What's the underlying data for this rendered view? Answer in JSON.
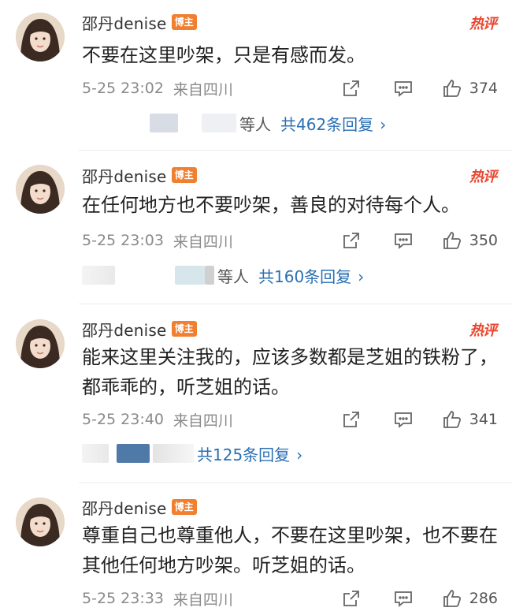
{
  "comments": [
    {
      "username": "邵丹denise",
      "badge": "博主",
      "hot_tag": "热评",
      "text": "不要在这里吵架，只是有感而发。",
      "time": "5-25 23:02",
      "location": "来自四川",
      "likes": "374",
      "reply_prefix": "等人",
      "reply_link": "共462条回复",
      "chevron": "›"
    },
    {
      "username": "邵丹denise",
      "badge": "博主",
      "hot_tag": "热评",
      "text": "在任何地方也不要吵架，善良的对待每个人。",
      "time": "5-25 23:03",
      "location": "来自四川",
      "likes": "350",
      "reply_prefix": "等人",
      "reply_link": "共160条回复",
      "chevron": "›"
    },
    {
      "username": "邵丹denise",
      "badge": "博主",
      "hot_tag": "热评",
      "text": "能来这里关注我的，应该多数都是芝姐的铁粉了，都乖乖的，听芝姐的话。",
      "time": "5-25 23:40",
      "location": "来自四川",
      "likes": "341",
      "reply_prefix": "",
      "reply_link": "共125条回复",
      "chevron": "›"
    },
    {
      "username": "邵丹denise",
      "badge": "博主",
      "hot_tag": "",
      "text": "尊重自己也尊重他人，不要在这里吵架，也不要在其他任何地方吵架。听芝姐的话。",
      "time": "5-25 23:33",
      "location": "来自四川",
      "likes": "286"
    }
  ],
  "colors": {
    "accent_link": "#2a6fb3",
    "badge": "#f07f2f",
    "hot_tag": "#e8462f",
    "meta_gray": "#8a8a8a"
  },
  "icons": {
    "share": "share-icon",
    "comment": "comment-icon",
    "like": "thumbs-up-icon"
  }
}
